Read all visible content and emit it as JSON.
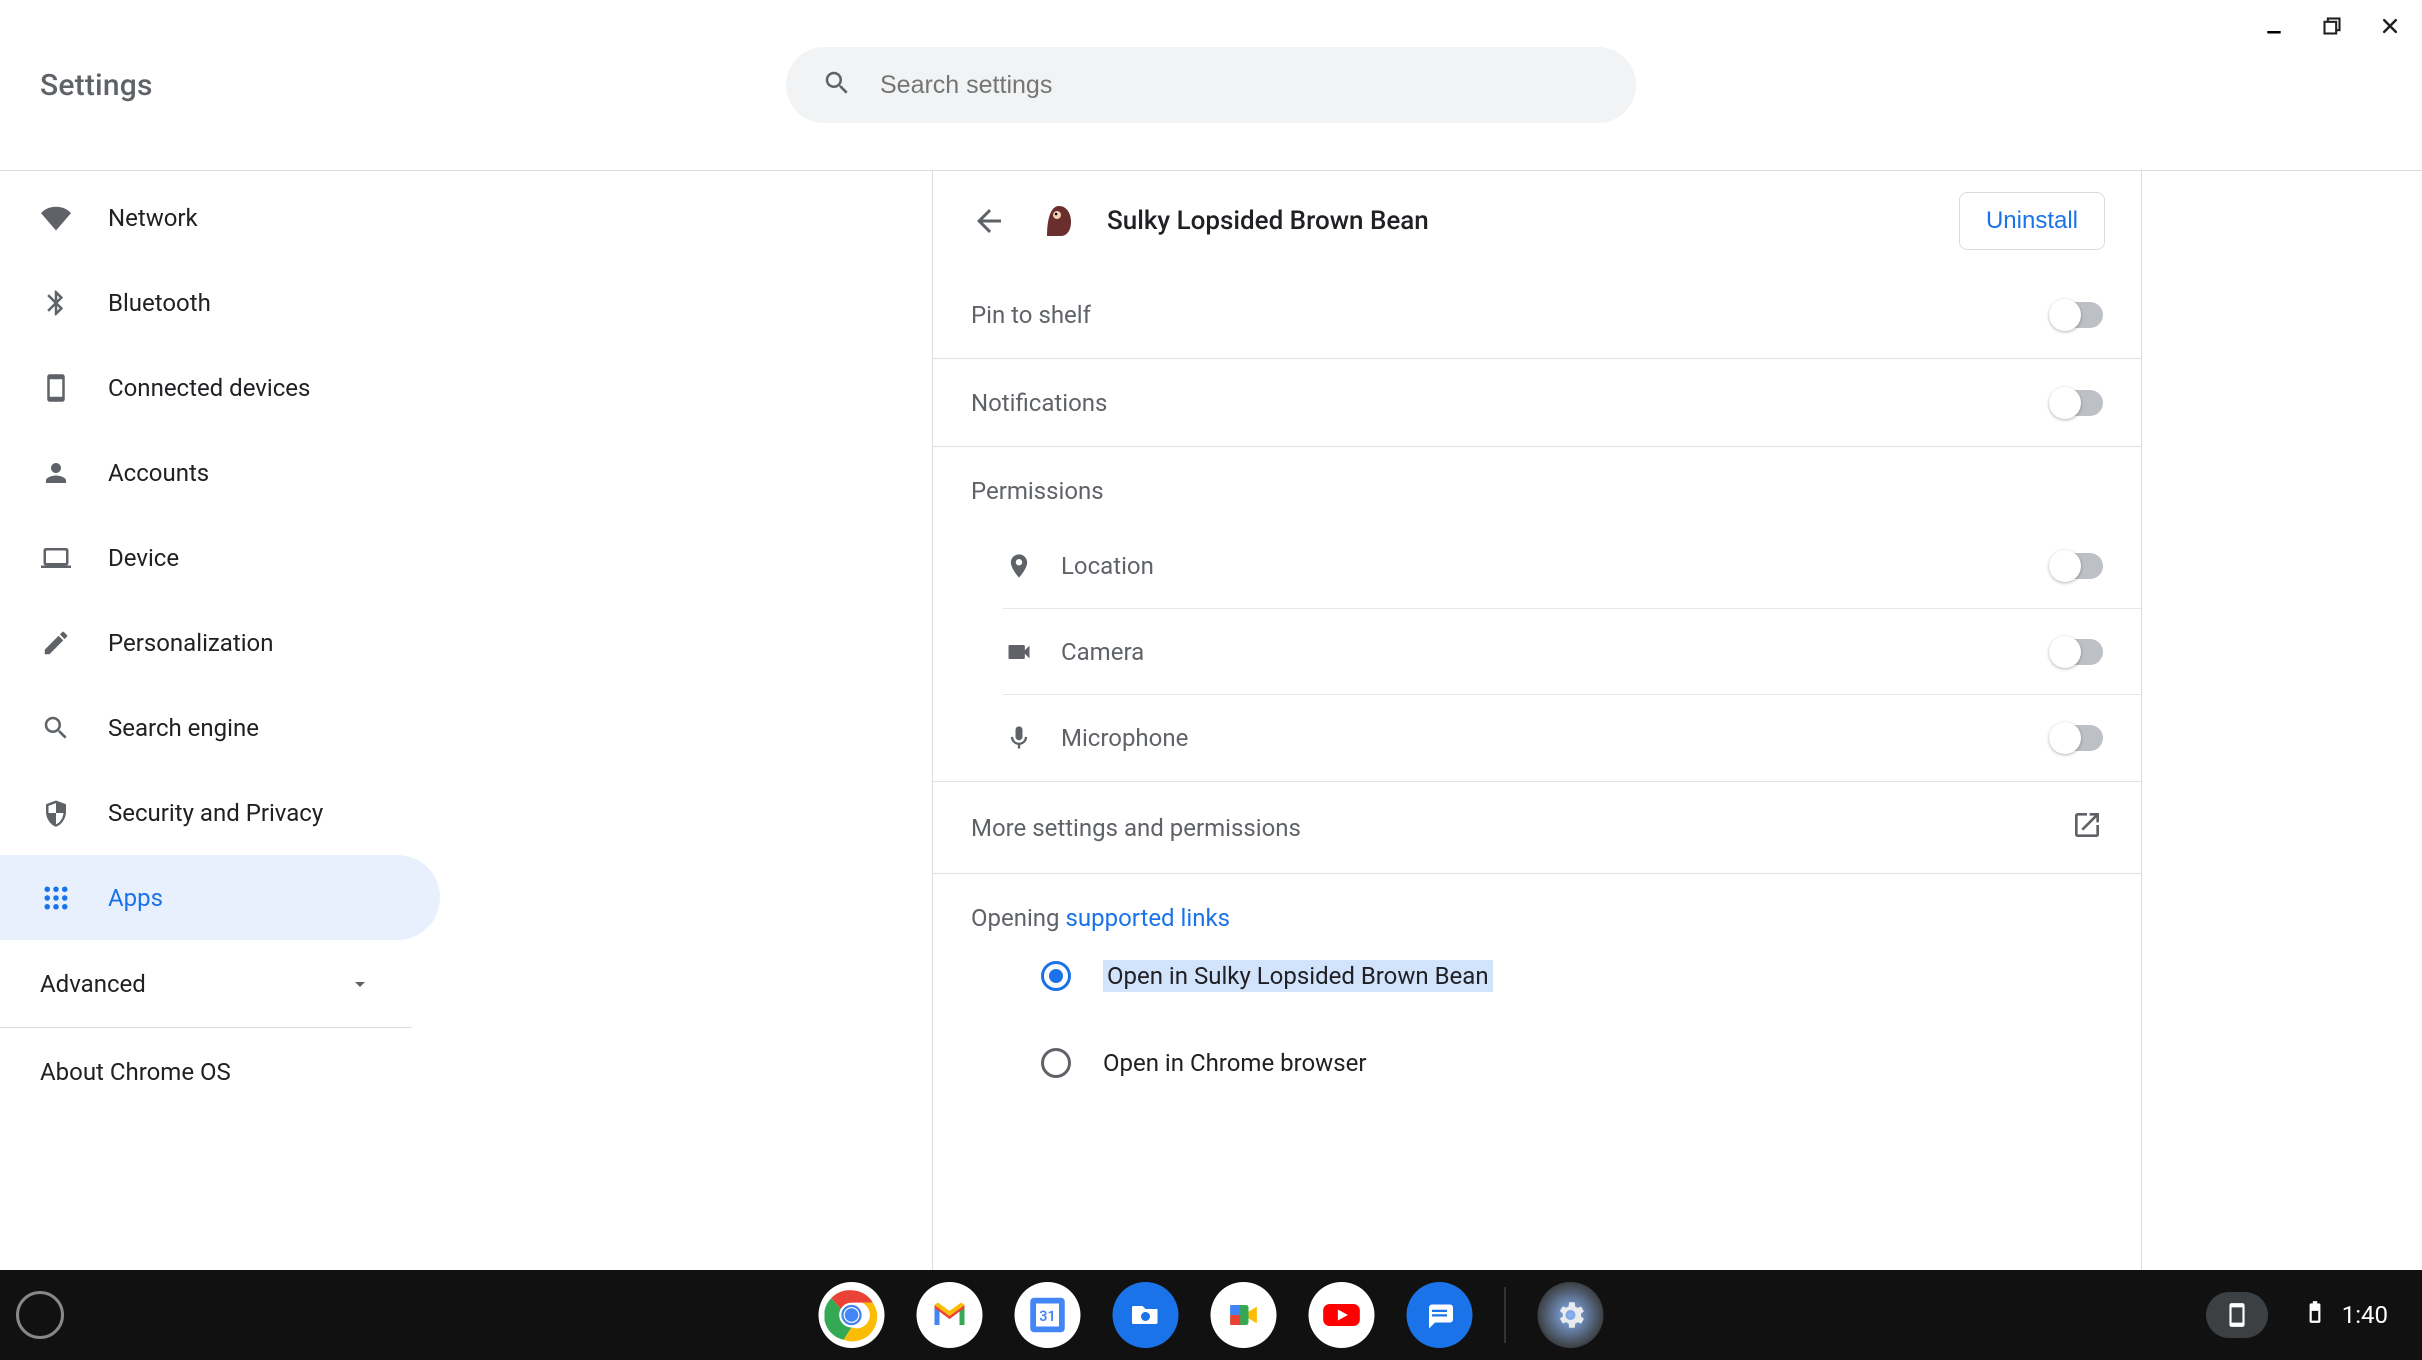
{
  "header": {
    "title": "Settings"
  },
  "search": {
    "placeholder": "Search settings"
  },
  "sidebar": {
    "items": [
      {
        "label": "Network"
      },
      {
        "label": "Bluetooth"
      },
      {
        "label": "Connected devices"
      },
      {
        "label": "Accounts"
      },
      {
        "label": "Device"
      },
      {
        "label": "Personalization"
      },
      {
        "label": "Search engine"
      },
      {
        "label": "Security and Privacy"
      },
      {
        "label": "Apps"
      }
    ],
    "advanced": "Advanced",
    "about": "About Chrome OS"
  },
  "app": {
    "name": "Sulky Lopsided Brown Bean",
    "uninstall": "Uninstall"
  },
  "settings": {
    "pin": "Pin to shelf",
    "notifications": "Notifications",
    "permissions_header": "Permissions",
    "permissions": {
      "location": "Location",
      "camera": "Camera",
      "microphone": "Microphone"
    },
    "more": "More settings and permissions",
    "opening_prefix": "Opening ",
    "opening_link": "supported links",
    "radio1": "Open in Sulky Lopsided Brown Bean",
    "radio2": "Open in Chrome browser"
  },
  "shelf": {
    "calendar_day": "31",
    "time": "1:40"
  }
}
